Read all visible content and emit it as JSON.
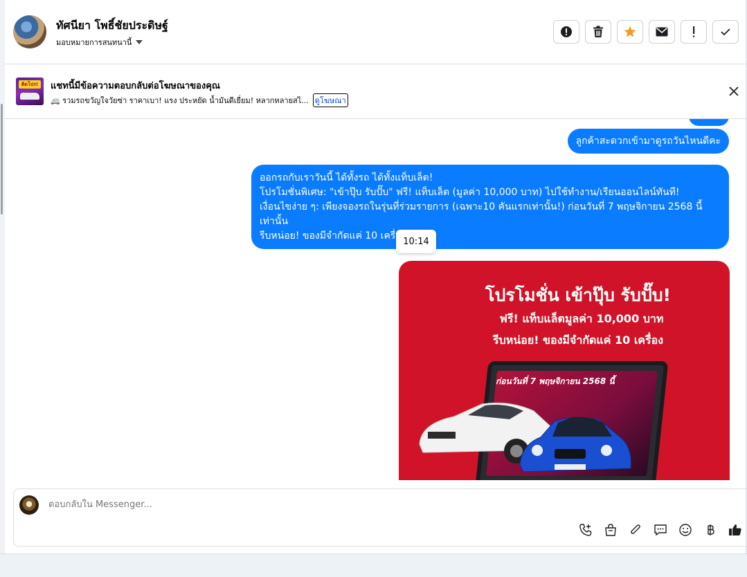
{
  "header": {
    "contact_name": "ทัศนียา โพธิ์ชัยประดิษฐ์",
    "assignee_label": "มอบหมายการสนทนานี้",
    "toolbar": [
      {
        "name": "report-button",
        "icon": "alert-circle-icon"
      },
      {
        "name": "delete-button",
        "icon": "trash-icon"
      },
      {
        "name": "star-button",
        "icon": "star-icon",
        "color": "#f59b23"
      },
      {
        "name": "mail-button",
        "icon": "envelope-icon"
      },
      {
        "name": "follow-up-button",
        "icon": "exclamation-icon"
      },
      {
        "name": "done-button",
        "icon": "check-icon"
      }
    ]
  },
  "ad_banner": {
    "title": "แชทนี้มีข้อความตอบกลับต่อโฆษณาของคุณ",
    "preview": "🚐 รวมรถขวัญใจวัยซ่า ราคาเบา! แรง ประหยัด น้ำมันดีเยี่ยม! หลากหลายสไ...",
    "link_label": "ดูโฆษณา",
    "thumb_text": "ติดโปร!"
  },
  "messages": {
    "short": "ลูกค้าสะดวกเข้ามาดูรถวันไหนดีคะ",
    "long_lines": [
      "ออกรถกับเราวันนี้ ได้ทั้งรถ ได้ทั้งแท็บเล็ต!",
      "โปรโมชั่นพิเศษ: \"เข้าปุ๊บ รับปั๊บ\" ฟรี! แท็บเล็ต (มูลค่า 10,000 บาท) ไปใช้ทำงาน/เรียนออนไลน์ทันที!",
      "เงื่อนไขง่าย ๆ: เพียงจองรถในรุ่นที่ร่วมรายการ (เฉพาะ10 คันแรกเท่านั้น!) ก่อนวันที่ 7 พฤษจิกายน 2568 นี้เท่านั้น",
      "รีบหน่อย! ของมีจำกัดแค่ 10 เครื่อง"
    ],
    "timestamp": "10:14"
  },
  "promo_image": {
    "title": "โปรโมชั่น เข้าปุ๊บ รับปั๊บ!",
    "line1": "ฟรี! แท็บแล็ตมูลค่า 10,000 บาท",
    "line2": "รีบหน่อย! ของมีจำกัดแค่ 10 เครื่อง",
    "tablet_text": "ก่อนวันที่ 7 พฤษจิกายน 2568 นี้",
    "bg_color": "#d01328"
  },
  "composer": {
    "placeholder": "ตอบกลับใน Messenger...",
    "icons": [
      "call-add-icon",
      "shopping-bag-icon",
      "paperclip-icon",
      "saved-reply-icon",
      "emoji-icon",
      "baht-icon",
      "thumbs-up-icon"
    ],
    "accent": "#0a7cff"
  }
}
